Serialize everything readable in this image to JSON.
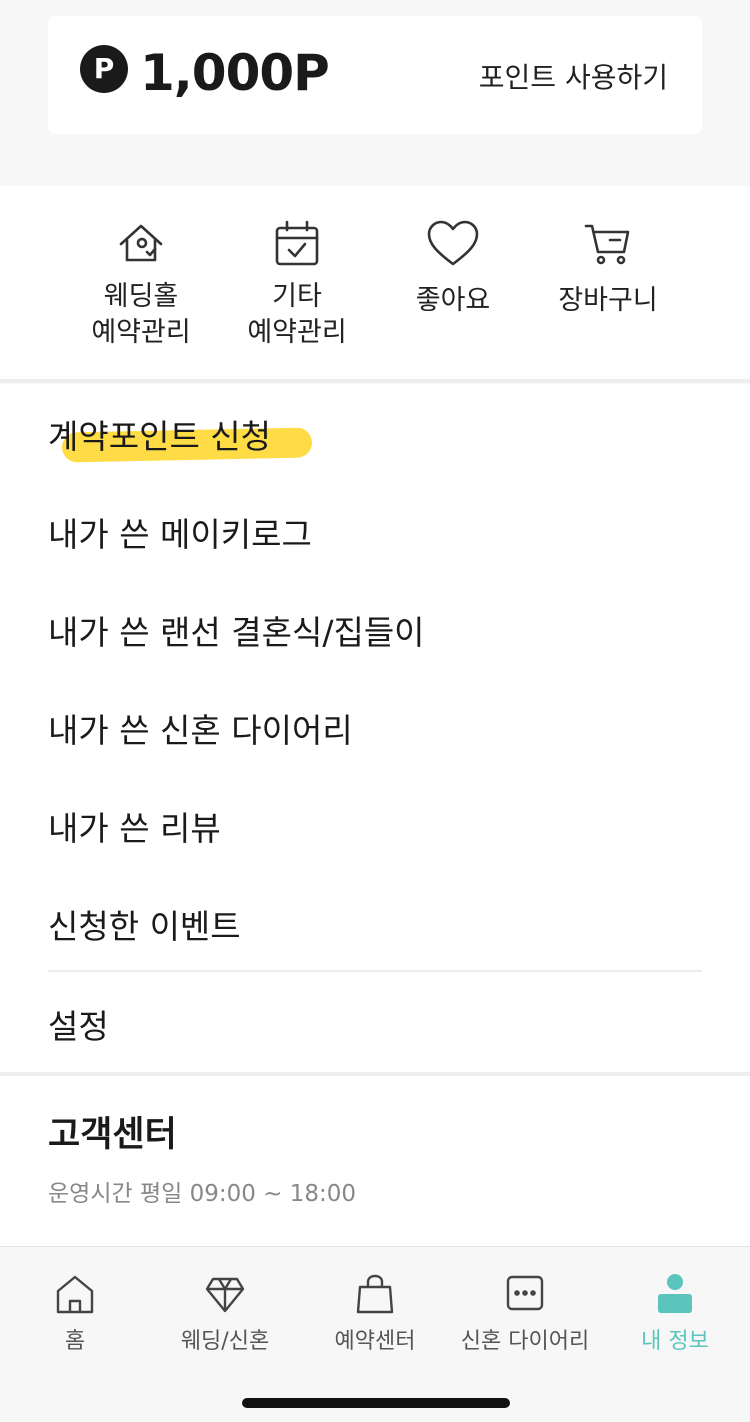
{
  "points": {
    "badge": "P",
    "amount": "1,000P",
    "use_label": "포인트 사용하기"
  },
  "quick_menu": [
    {
      "icon": "wedding-hall-icon",
      "line1": "웨딩홀",
      "line2": "예약관리"
    },
    {
      "icon": "calendar-check-icon",
      "line1": "기타",
      "line2": "예약관리"
    },
    {
      "icon": "heart-icon",
      "line1": "좋아요",
      "line2": ""
    },
    {
      "icon": "cart-icon",
      "line1": "장바구니",
      "line2": ""
    }
  ],
  "menu": {
    "items": [
      "계약포인트 신청",
      "내가 쓴 메이키로그",
      "내가 쓴 랜선 결혼식/집들이",
      "내가 쓴 신혼 다이어리",
      "내가 쓴 리뷰",
      "신청한 이벤트"
    ],
    "settings": "설정",
    "highlight_color": "#ffd93b"
  },
  "customer_center": {
    "title": "고객센터",
    "hours": "운영시간 평일 09:00 ~ 18:00"
  },
  "tabbar": {
    "active_color": "#5bc4bc",
    "tabs": [
      {
        "icon": "home-icon",
        "label": "홈"
      },
      {
        "icon": "diamond-icon",
        "label": "웨딩/신혼"
      },
      {
        "icon": "shopping-bag-icon",
        "label": "예약센터"
      },
      {
        "icon": "chat-bubble-icon",
        "label": "신혼 다이어리"
      },
      {
        "icon": "profile-icon",
        "label": "내 정보"
      }
    ]
  }
}
